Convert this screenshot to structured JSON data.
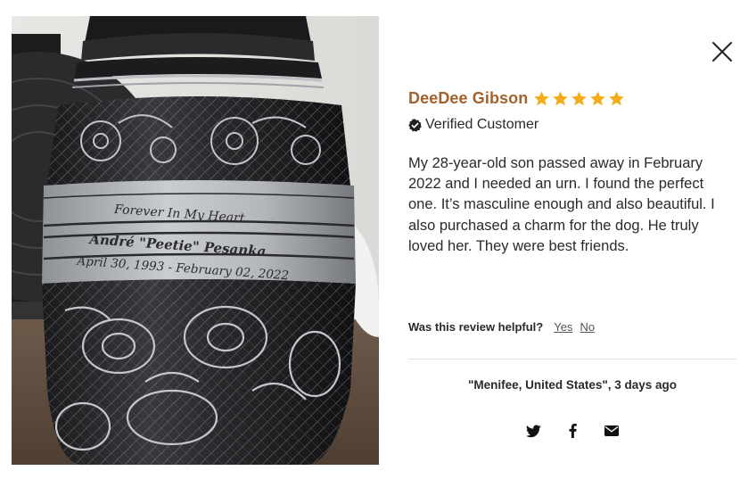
{
  "review": {
    "reviewer_name": "DeeDee Gibson",
    "rating": 5,
    "star_color": "#f3ad1d",
    "name_color": "#a1622c",
    "verified_label": "Verified Customer",
    "body": "My 28-year-old son passed away in February 2022 and I needed an urn. I found the perfect one. It’s masculine enough and also beautiful. I also purchased a charm for the dog. He truly loved her. They were best friends.",
    "location_time": "\"Menifee, United States\", 3 days ago"
  },
  "helpful": {
    "question": "Was this review helpful?",
    "yes_label": "Yes",
    "no_label": "No"
  },
  "photo": {
    "engraving_line1": "Forever In My Heart",
    "engraving_line2": "André \"Peetie\" Pesanka",
    "engraving_line3": "April 30, 1993 - February 02, 2022"
  },
  "icons": {
    "close": "close-icon",
    "verified": "verified-badge-icon",
    "star": "star-icon",
    "share_twitter": "twitter-icon",
    "share_facebook": "facebook-icon",
    "share_email": "email-icon"
  }
}
